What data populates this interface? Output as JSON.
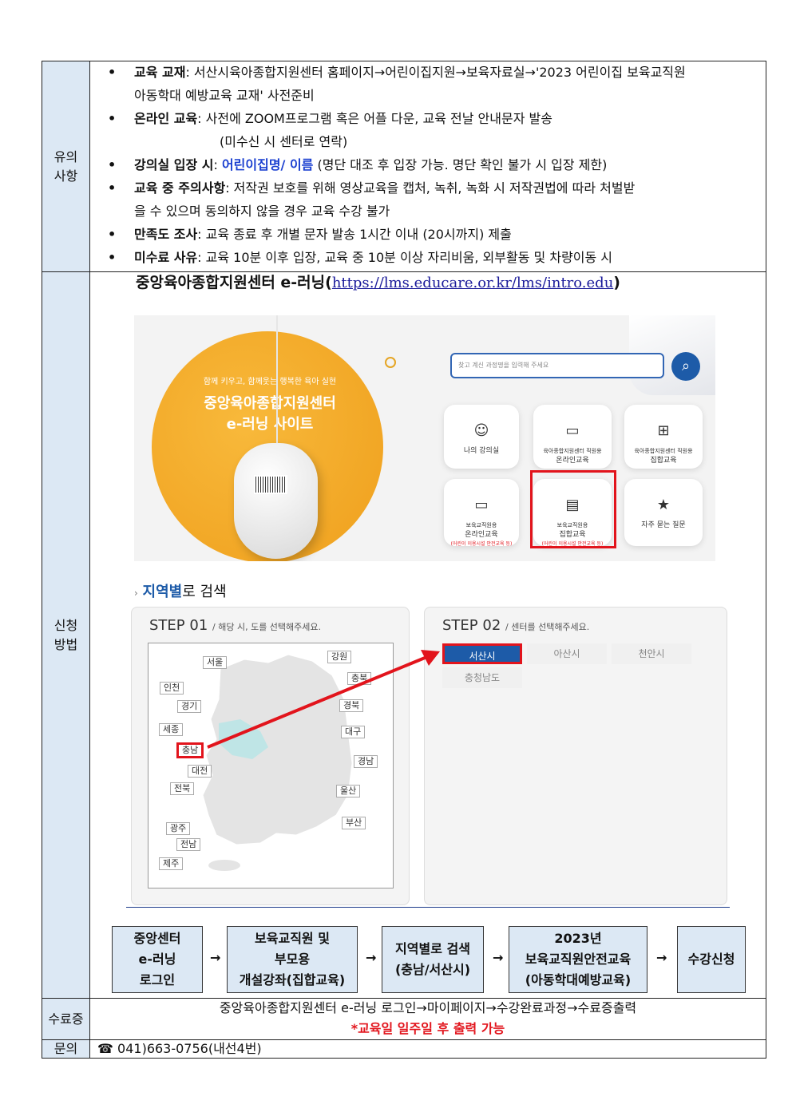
{
  "notes": {
    "label": "유의\n사항",
    "items": [
      {
        "bullet": "•",
        "title": "교육 교재",
        "text": ": 서산시육아종합지원센터 홈페이지→어린이집지원→보육자료실→'2023 어린이집 보육교직원",
        "text2": "아동학대 예방교육 교재' 사전준비"
      },
      {
        "bullet": "•",
        "title": "온라인 교육",
        "text": ": 사전에 ZOOM프로그램 혹은 어플 다운, 교육 전날 안내문자 발송",
        "text2": "(미수신 시 센터로 연락)"
      },
      {
        "bullet": "•",
        "title": "강의실 입장 시",
        "colon": ":",
        "highlight": "어린이집명/ 이름",
        "text": " (명단 대조 후 입장 가능. 명단 확인 불가 시 입장 제한)"
      },
      {
        "bullet": "•",
        "title": "교육 중 주의사항",
        "text": ": 저작권 보호를 위해 영상교육을 캡처, 녹취, 녹화 시 저작권법에 따라 처벌받",
        "text2": "을 수 있으며 동의하지 않을 경우 교육 수강 불가"
      },
      {
        "bullet": "•",
        "title": "만족도 조사",
        "text": ": 교육 종료 후 개별 문자 발송 1시간 이내 (20시까지) 제출"
      },
      {
        "bullet": "•",
        "title": "미수료 사유",
        "text": ": 교육 10분 이후 입장, 교육 중 10분 이상 자리비움, 외부활동 및 차량이동 시"
      }
    ]
  },
  "apply": {
    "label": "신청\n방법",
    "heading": "중앙육아종합지원센터 e-러닝",
    "url": "https://lms.educare.or.kr/lms/intro.edu",
    "paren_open": "(",
    "paren_close": ")",
    "banner": {
      "slogan": "함께 키우고, 함께웃는 행복한 육아 실현",
      "title1": "중앙육아종합지원센터",
      "title2": "e-러닝 사이트",
      "search_placeholder": "찾고 계신 과정명을 입력해 주세요",
      "tiles": [
        {
          "icon": "☺",
          "line1": "나의 강의실",
          "line2": "",
          "line3": ""
        },
        {
          "icon": "▭",
          "line1": "육아종합지원센터 직원용",
          "line2": "온라인교육",
          "line3": ""
        },
        {
          "icon": "⊞",
          "line1": "육아종합지원센터 직원용",
          "line2": "집합교육",
          "line3": ""
        },
        {
          "icon": "▭",
          "line1": "보육교직원용",
          "line2": "온라인교육",
          "line3": "(어린이 이용시설 안전교육 등)"
        },
        {
          "icon": "▤",
          "line1": "보육교직원용",
          "line2": "집합교육",
          "line3": "(어린이 이용시설 안전교육 등)"
        },
        {
          "icon": "★",
          "line1": "자주 묻는 질문",
          "line2": "",
          "line3": ""
        }
      ]
    },
    "region_search": {
      "title_highlight": "지역별",
      "title_rest": "로 검색",
      "step1": {
        "title": "STEP 01",
        "sub": "/ 해당 시, 도를 선택해주세요."
      },
      "step2": {
        "title": "STEP 02",
        "sub": "/ 센터를 선택해주세요."
      },
      "regions": [
        "서울",
        "강원",
        "충북",
        "인천",
        "경기",
        "경북",
        "세종",
        "대구",
        "충남",
        "경남",
        "대전",
        "전북",
        "울산",
        "광주",
        "부산",
        "전남",
        "제주"
      ],
      "cities": [
        "서산시",
        "아산시",
        "천안시",
        "충청남도"
      ]
    },
    "flow": [
      {
        "line1": "중앙센터",
        "line2": "e-러닝",
        "line3": "로그인"
      },
      {
        "line1": "보육교직원 및",
        "line2": "부모용",
        "line3": "개설강좌(집합교육)"
      },
      {
        "line1": "지역별로 검색",
        "line2": "(충남/서산시)",
        "line3": ""
      },
      {
        "line1": "2023년",
        "line2": "보육교직원안전교육",
        "line3": "(아동학대예방교육)"
      },
      {
        "line1": "수강신청",
        "line2": "",
        "line3": ""
      }
    ],
    "arrow": "→"
  },
  "certificate": {
    "label": "수료증",
    "text": "중앙육아종합지원센터 e-러닝 로그인→마이페이지→수강완료과정→수료증출력",
    "note": "*교육일 일주일 후 출력 가능"
  },
  "contact": {
    "label": "문의",
    "icon": "☎",
    "phone": "041)663-0756(내선4번)"
  }
}
